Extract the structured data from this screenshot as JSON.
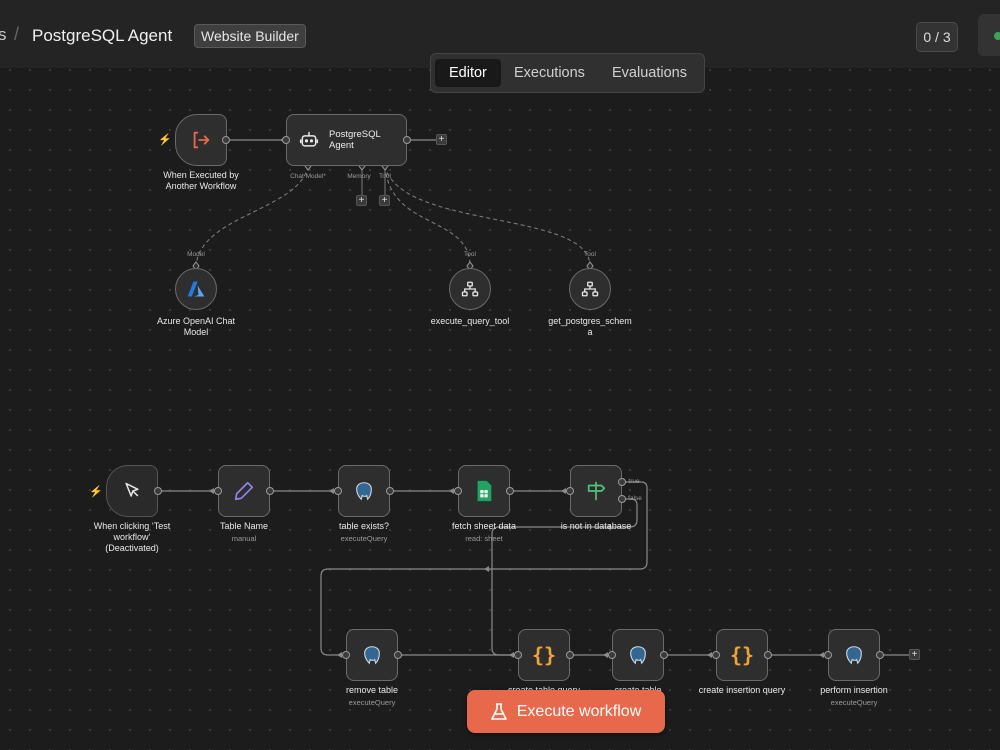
{
  "header": {
    "breadcrumb_prev": "s",
    "breadcrumb_sep": "/",
    "workflow_title": "PostgreSQL Agent",
    "tag": "Website Builder",
    "counter": "0 / 3"
  },
  "tabs": [
    "Editor",
    "Executions",
    "Evaluations"
  ],
  "colors": {
    "accent": "#e8684c",
    "status": "#3fa357",
    "canvas": "#1c1c1c"
  },
  "nodes": {
    "exec_trigger": {
      "label": "When Executed by Another Workflow",
      "icon": "sign-in-icon"
    },
    "agent": {
      "label": "PostgreSQL Agent",
      "icon": "robot-icon",
      "ports": [
        "Chat Model*",
        "Memory",
        "Tool"
      ]
    },
    "azure": {
      "label": "Azure OpenAI Chat Model",
      "port": "Model",
      "icon": "azure-icon"
    },
    "exec_query_tool": {
      "label": "execute_query_tool",
      "port": "Tool",
      "icon": "sitemap-icon"
    },
    "get_schema": {
      "label": "get_postgres_schema",
      "port": "Tool",
      "icon": "sitemap-icon"
    },
    "manual_trigger": {
      "label": "When clicking ‘Test workflow’",
      "note": "(Deactivated)",
      "icon": "cursor-icon"
    },
    "table_name": {
      "label": "Table Name",
      "sub": "manual",
      "icon": "pencil-icon"
    },
    "table_exists": {
      "label": "table exists?",
      "sub": "executeQuery",
      "icon": "postgres-icon"
    },
    "fetch_sheet": {
      "label": "fetch sheet data",
      "sub": "read: sheet",
      "icon": "sheets-icon"
    },
    "not_in_db": {
      "label": "is not in database",
      "true_label": "true",
      "false_label": "false",
      "icon": "signpost-icon"
    },
    "remove_table": {
      "label": "remove table",
      "sub": "executeQuery",
      "icon": "postgres-icon"
    },
    "create_table_query": {
      "label": "create table query",
      "icon": "code-icon"
    },
    "create_table": {
      "label": "create table",
      "icon": "postgres-icon"
    },
    "create_insertion_query": {
      "label": "create insertion query",
      "icon": "code-icon"
    },
    "perform_insertion": {
      "label": "perform insertion",
      "sub": "executeQuery",
      "icon": "postgres-icon"
    }
  },
  "execute_button": {
    "label": "Execute workflow",
    "icon": "flask-icon"
  }
}
